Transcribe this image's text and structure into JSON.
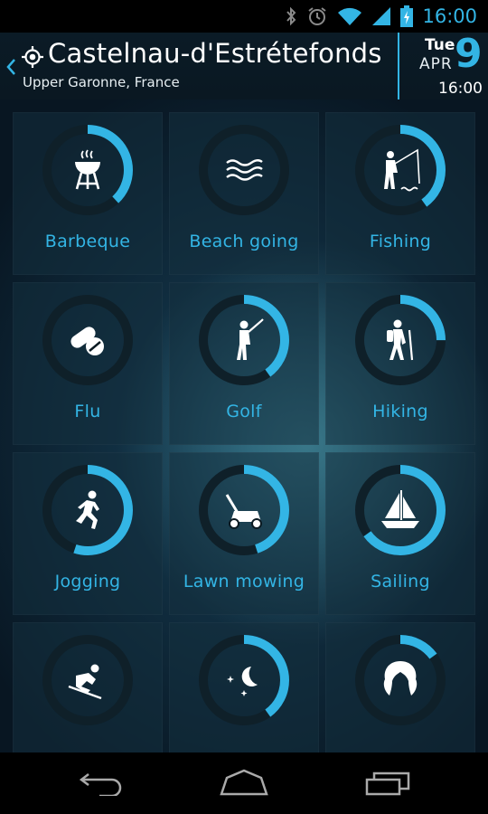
{
  "status": {
    "time": "16:00"
  },
  "header": {
    "city": "Castelnau-d'Estrétefonds",
    "region": "Upper Garonne, France",
    "date": {
      "day_of_week": "Tue",
      "month": "APR",
      "day": "9",
      "time": "16:00"
    }
  },
  "activities": [
    {
      "name": "Barbeque",
      "icon": "barbeque-icon",
      "level": 0.38
    },
    {
      "name": "Beach going",
      "icon": "waves-icon",
      "level": 0.0
    },
    {
      "name": "Fishing",
      "icon": "fishing-icon",
      "level": 0.4
    },
    {
      "name": "Flu",
      "icon": "pills-icon",
      "level": 0.0
    },
    {
      "name": "Golf",
      "icon": "golf-icon",
      "level": 0.4
    },
    {
      "name": "Hiking",
      "icon": "hiking-icon",
      "level": 0.25
    },
    {
      "name": "Jogging",
      "icon": "jogging-icon",
      "level": 0.55
    },
    {
      "name": "Lawn mowing",
      "icon": "lawn-mower-icon",
      "level": 0.45
    },
    {
      "name": "Sailing",
      "icon": "sailboat-icon",
      "level": 0.65
    },
    {
      "name": "",
      "icon": "skiing-icon",
      "level": 0.0
    },
    {
      "name": "",
      "icon": "night-sky-icon",
      "level": 0.4
    },
    {
      "name": "",
      "icon": "hair-icon",
      "level": 0.15
    }
  ],
  "colors": {
    "accent": "#33b5e5",
    "ring_track": "#0f2029",
    "tile": "#14303e"
  }
}
